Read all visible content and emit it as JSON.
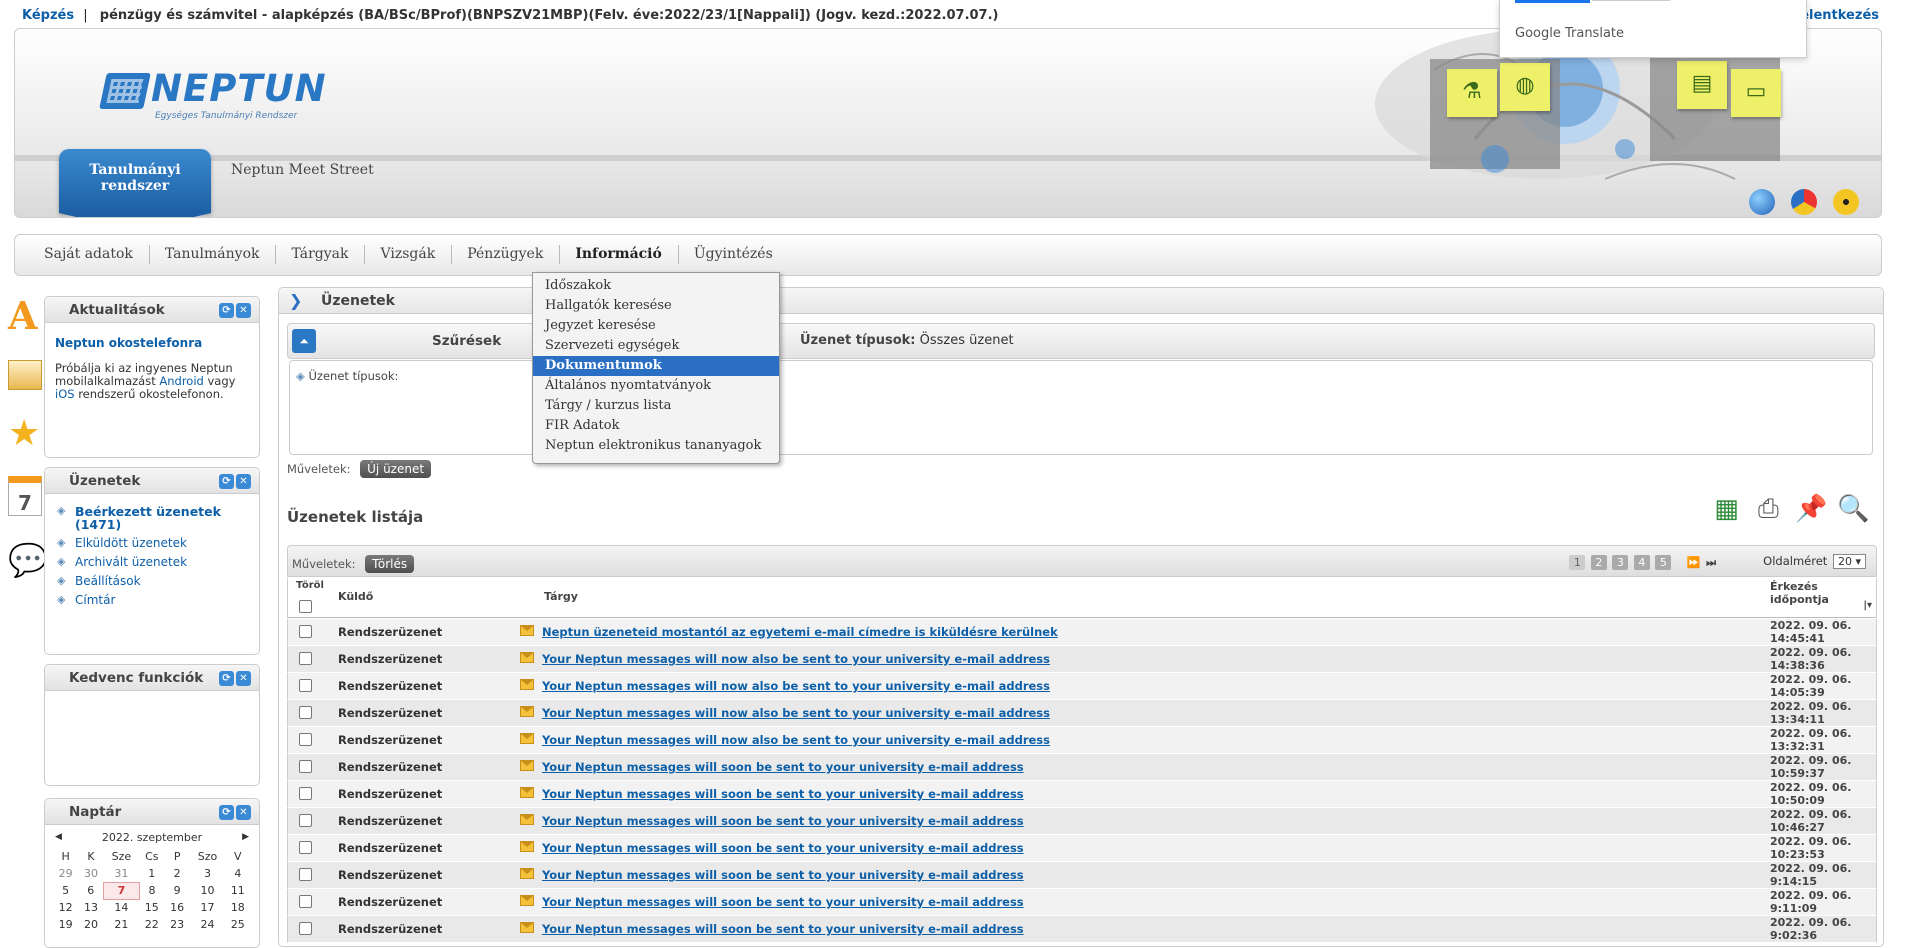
{
  "topbar": {
    "kepzes": "Képzés",
    "separator": "|",
    "program": "pénzügy és számvitel - alapképzés (BA/BSc/BProf)(BNPSZV21MBP)(Felv. éve:2022/23/1[Nappali]) (Jogv. kezd.:2022.07.07.)",
    "right_link": "elentkezés"
  },
  "google_translate": {
    "label": "Google Translate"
  },
  "header": {
    "logo_text": "NEPTUN",
    "logo_tagline": "Egységes Tanulmányi Rendszer",
    "tab_active": "Tanulmányi rendszer",
    "tab_other": "Neptun Meet Street"
  },
  "menu": {
    "items": [
      "Saját adatok",
      "Tanulmányok",
      "Tárgyak",
      "Vizsgák",
      "Pénzügyek",
      "Információ",
      "Ügyintézés"
    ],
    "active": "Információ",
    "dropdown": [
      "Időszakok",
      "Hallgatók keresése",
      "Jegyzet keresése",
      "Szervezeti egységek",
      "Dokumentumok",
      "Általános nyomtatványok",
      "Tárgy / kurzus lista",
      "FIR Adatok",
      "Neptun elektronikus tananyagok"
    ],
    "dropdown_selected": "Dokumentumok"
  },
  "boxes": {
    "news": {
      "title": "Aktualitások",
      "headline": "Neptun okostelefonra",
      "text1": "Próbálja ki az ingyenes Neptun mobilalkalmazást",
      "link_android": "Android",
      "text2": "vagy",
      "link_ios": "iOS",
      "text3": "rendszerű okostelefonon."
    },
    "messages": {
      "title": "Üzenetek",
      "items": [
        "Beérkezett üzenetek (1471)",
        "Elküldött üzenetek",
        "Archivált üzenetek",
        "Beállítások",
        "Címtár"
      ]
    },
    "favorites": {
      "title": "Kedvenc funkciók"
    },
    "calendar": {
      "title": "Naptár",
      "month": "2022. szeptember",
      "days": [
        "H",
        "K",
        "Sze",
        "Cs",
        "P",
        "Szo",
        "V"
      ],
      "weeks": [
        [
          "29",
          "30",
          "31",
          "1",
          "2",
          "3",
          "4"
        ],
        [
          "5",
          "6",
          "7",
          "8",
          "9",
          "10",
          "11"
        ],
        [
          "12",
          "13",
          "14",
          "15",
          "16",
          "17",
          "18"
        ],
        [
          "19",
          "20",
          "21",
          "22",
          "23",
          "24",
          "25"
        ]
      ],
      "today": "7"
    }
  },
  "main": {
    "title": "Üzenetek",
    "filter_label": "Szűrések",
    "types_label": "Üzenet típusok:",
    "types_value": "Összes üzenet",
    "filter_field_label": "Üzenet típusok:",
    "ops_label": "Műveletek:",
    "new_message": "Új üzenet",
    "list_title": "Üzenetek listája",
    "delete_btn": "Törlés",
    "pages": [
      "1",
      "2",
      "3",
      "4",
      "5"
    ],
    "current_page": "1",
    "pagesize_label": "Oldalméret",
    "pagesize_value": "20",
    "col_torol": "Töröl",
    "col_sender": "Küldő",
    "col_subject": "Tárgy",
    "col_date": "Érkezés időpontja",
    "rows": [
      {
        "from": "Rendszerüzenet",
        "subject": "Neptun üzeneteid mostantól az egyetemi e-mail címedre is kiküldésre kerülnek",
        "date": "2022. 09. 06.",
        "time": "14:45:41"
      },
      {
        "from": "Rendszerüzenet",
        "subject": "Your Neptun messages will now also be sent to your university e-mail address",
        "date": "2022. 09. 06.",
        "time": "14:38:36"
      },
      {
        "from": "Rendszerüzenet",
        "subject": "Your Neptun messages will now also be sent to your university e-mail address",
        "date": "2022. 09. 06.",
        "time": "14:05:39"
      },
      {
        "from": "Rendszerüzenet",
        "subject": "Your Neptun messages will now also be sent to your university e-mail address",
        "date": "2022. 09. 06.",
        "time": "13:34:11"
      },
      {
        "from": "Rendszerüzenet",
        "subject": "Your Neptun messages will now also be sent to your university e-mail address",
        "date": "2022. 09. 06.",
        "time": "13:32:31"
      },
      {
        "from": "Rendszerüzenet",
        "subject": "Your Neptun messages will soon be sent to your university e-mail address",
        "date": "2022. 09. 06.",
        "time": "10:59:37"
      },
      {
        "from": "Rendszerüzenet",
        "subject": "Your Neptun messages will soon be sent to your university e-mail address",
        "date": "2022. 09. 06.",
        "time": "10:50:09"
      },
      {
        "from": "Rendszerüzenet",
        "subject": "Your Neptun messages will soon be sent to your university e-mail address",
        "date": "2022. 09. 06.",
        "time": "10:46:27"
      },
      {
        "from": "Rendszerüzenet",
        "subject": "Your Neptun messages will soon be sent to your university e-mail address",
        "date": "2022. 09. 06.",
        "time": "10:23:53"
      },
      {
        "from": "Rendszerüzenet",
        "subject": "Your Neptun messages will soon be sent to your university e-mail address",
        "date": "2022. 09. 06.",
        "time": "9:14:15"
      },
      {
        "from": "Rendszerüzenet",
        "subject": "Your Neptun messages will soon be sent to your university e-mail address",
        "date": "2022. 09. 06.",
        "time": "9:11:09"
      },
      {
        "from": "Rendszerüzenet",
        "subject": "Your Neptun messages will soon be sent to your university e-mail address",
        "date": "2022. 09. 06.",
        "time": "9:02:36"
      }
    ]
  },
  "colors": {
    "accent": "#2a77c4",
    "link": "#0d5fa8",
    "highlight": "#2a6fc4"
  }
}
